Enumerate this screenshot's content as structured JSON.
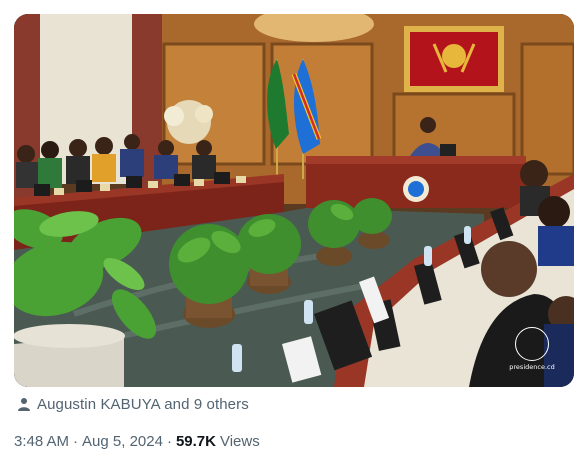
{
  "photo": {
    "watermark_text": "presidence.cd"
  },
  "tagged": {
    "icon": "person-icon",
    "text": "Augustin KABUYA and 9 others"
  },
  "meta": {
    "time": "3:48 AM",
    "separator": "·",
    "date": "Aug 5, 2024",
    "views_count": "59.7K",
    "views_label": "Views"
  },
  "colors": {
    "secondary_text": "#536471",
    "primary_text": "#0f1419"
  }
}
